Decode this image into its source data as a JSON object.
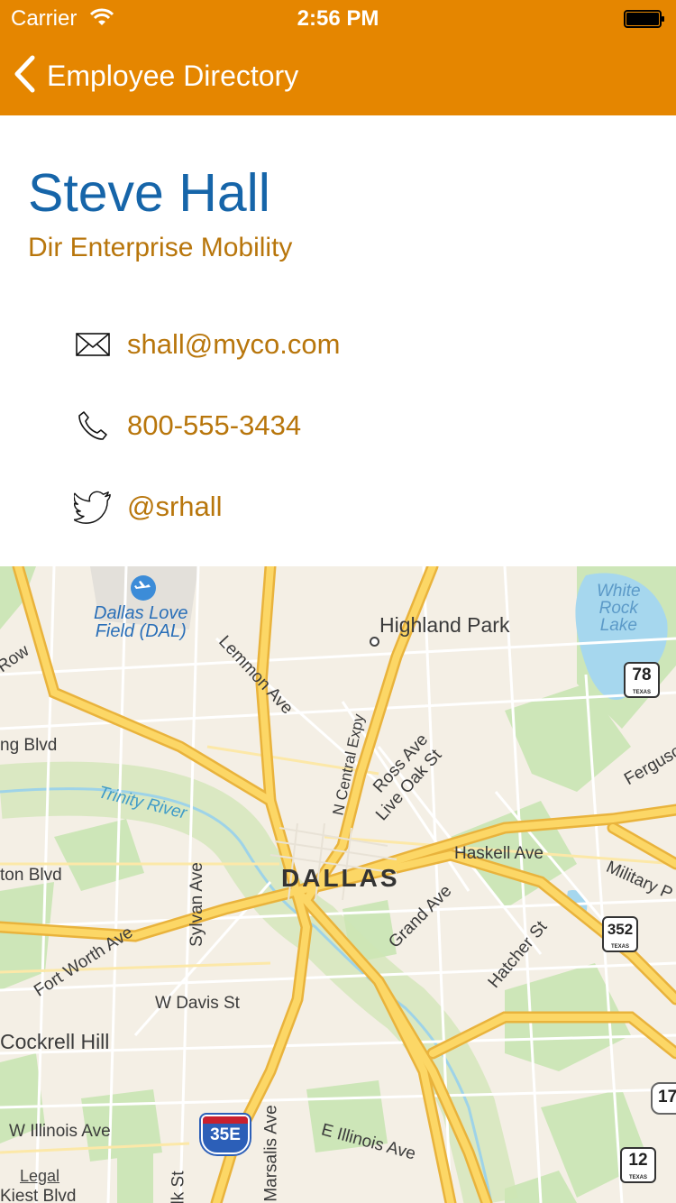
{
  "status": {
    "carrier": "Carrier",
    "time": "2:56 PM"
  },
  "nav": {
    "back_label": "Employee Directory"
  },
  "employee": {
    "name": "Steve Hall",
    "title": "Dir Enterprise Mobility",
    "email": "shall@myco.com",
    "phone": "800-555-3434",
    "twitter": "@srhall"
  },
  "map": {
    "labels": {
      "airport": "Dallas Love\nField (DAL)",
      "highland_park": "Highland Park",
      "white_rock_lake": "White\nRock\nLake",
      "lemmon_ave": "Lemmon Ave",
      "row": "Row",
      "ng_blvd": "ng Blvd",
      "trinity_river": "Trinity River",
      "n_central_expy": "N Central Expy",
      "ross_ave": "Ross Ave",
      "live_oak_st": "Live Oak St",
      "ferguson": "Ferguso",
      "haskell_ave": "Haskell Ave",
      "ton_blvd": "ton Blvd",
      "sylvan_ave": "Sylvan Ave",
      "dallas": "DALLAS",
      "military_p": "Military P",
      "grand_ave": "Grand Ave",
      "fort_worth_ave": "Fort Worth Ave",
      "hatcher_st": "Hatcher St",
      "w_davis_st": "W Davis St",
      "cockrell_hill": "Cockrell Hill",
      "w_illinois_ave": "W Illinois Ave",
      "marsalis_ave": "Marsalis Ave",
      "e_illinois_ave": "E Illinois Ave",
      "lk_st": "lk St",
      "kiest_blvd": "Kiest Blvd",
      "legal": "Legal"
    },
    "shields": {
      "tx78": "78",
      "tx352": "352",
      "tx12": "12",
      "i35e": "35E",
      "r17": "17",
      "texas": "TEXAS"
    }
  },
  "colors": {
    "nav_bar": "#E58600",
    "name": "#1665A9",
    "accent": "#B8760C"
  },
  "icons": [
    "back-chevron-icon",
    "wifi-icon",
    "battery-icon",
    "mail-icon",
    "phone-icon",
    "twitter-icon",
    "airport-icon"
  ]
}
